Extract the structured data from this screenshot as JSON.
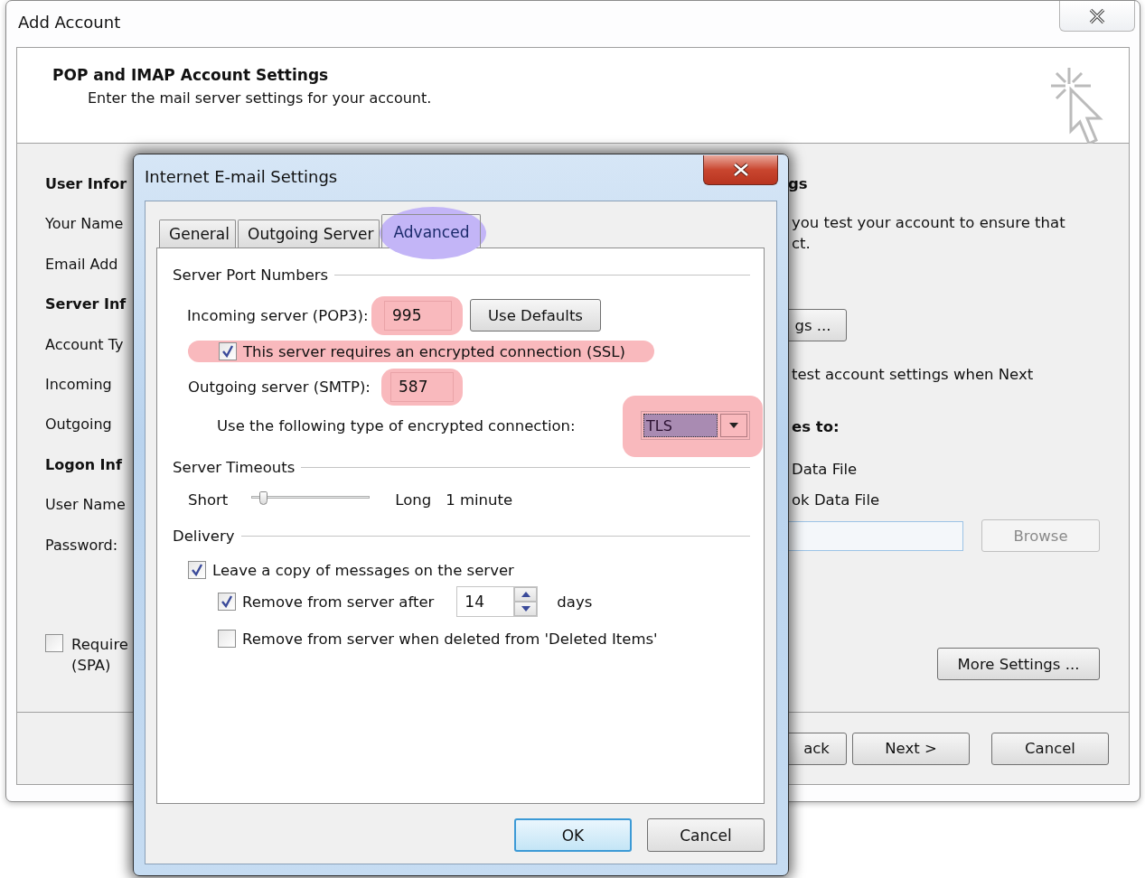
{
  "window": {
    "title": "Add Account"
  },
  "header": {
    "title": "POP and IMAP Account Settings",
    "subtitle": "Enter the mail server settings for your account."
  },
  "left_column": [
    {
      "kind": "heading",
      "text": "User Infor"
    },
    {
      "kind": "label",
      "text": "Your Name"
    },
    {
      "kind": "label",
      "text": "Email Add"
    },
    {
      "kind": "heading",
      "text": "Server Inf"
    },
    {
      "kind": "label",
      "text": "Account Ty"
    },
    {
      "kind": "label",
      "text": "Incoming"
    },
    {
      "kind": "label",
      "text": "Outgoing"
    },
    {
      "kind": "heading",
      "text": "Logon Inf"
    },
    {
      "kind": "label",
      "text": "User Name"
    },
    {
      "kind": "label",
      "text": "Password:"
    }
  ],
  "spa_option": {
    "lines": [
      "Require",
      "(SPA)"
    ],
    "checked": false
  },
  "right_panel": {
    "heading": "gs",
    "description": [
      "you test your account to ensure that",
      "ct."
    ],
    "test_button": "gs ...",
    "test_option": "test account settings when Next",
    "deliver_heading": "es to:",
    "deliver_options": [
      "Data File",
      "ok Data File"
    ],
    "browse_button": {
      "label": "Browse",
      "disabled": true
    },
    "more_settings_button": "More Settings ..."
  },
  "footer_buttons": [
    {
      "label": "ack"
    },
    {
      "label": "Next >"
    },
    {
      "label": "Cancel"
    }
  ],
  "dialog": {
    "title": "Internet E-mail Settings",
    "tabs": [
      {
        "label": "General",
        "selected": false,
        "highlighted": false
      },
      {
        "label": "Outgoing Server",
        "selected": false,
        "highlighted": false
      },
      {
        "label": "Advanced",
        "selected": true,
        "highlighted": true
      }
    ],
    "ports": {
      "title": "Server Port Numbers",
      "incoming": {
        "label": "Incoming server (POP3):",
        "value": "995",
        "highlighted": true
      },
      "use_defaults": "Use Defaults",
      "ssl": {
        "label": "This server requires an encrypted connection (SSL)",
        "checked": true,
        "highlighted": true
      },
      "outgoing": {
        "label": "Outgoing server (SMTP):",
        "value": "587",
        "highlighted": true
      },
      "encryption": {
        "label": "Use the following type of encrypted connection:",
        "value": "TLS",
        "highlighted": true
      }
    },
    "timeouts": {
      "title": "Server Timeouts",
      "min_label": "Short",
      "max_label": "Long",
      "level": 0.1,
      "reading": "1 minute"
    },
    "delivery": {
      "title": "Delivery",
      "leave_copy": {
        "label": "Leave a copy of messages on the server",
        "checked": true
      },
      "remove_after": {
        "label": "Remove from server after",
        "checked": true,
        "value": "14",
        "unit": "days"
      },
      "remove_deleted": {
        "label": "Remove from server when deleted from 'Deleted Items'",
        "checked": false
      }
    },
    "buttons": [
      {
        "label": "OK",
        "default": true
      },
      {
        "label": "Cancel",
        "default": false
      }
    ]
  }
}
